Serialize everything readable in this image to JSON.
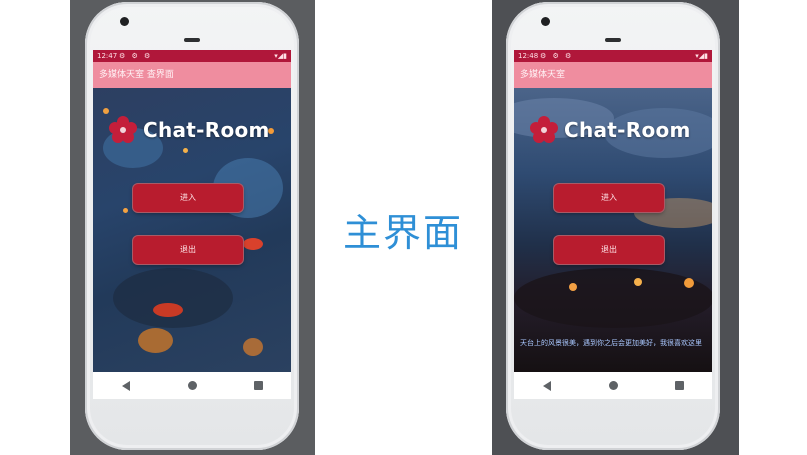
{
  "center_label": "主界面",
  "left_phone": {
    "status_time": "12:47",
    "status_icons": "⚙ ⚙ ⚙",
    "status_right": "▾◢▮",
    "app_title": "多媒体天室 查界面",
    "logo_text": "Chat-Room",
    "enter_button": "进入",
    "exit_button": "退出"
  },
  "right_phone": {
    "status_time": "12:48",
    "status_icons": "⚙ ⚙ ⚙",
    "status_right": "▾◢▮",
    "app_title": "多媒体天室",
    "logo_text": "Chat-Room",
    "enter_button": "进入",
    "exit_button": "退出",
    "caption": "天台上的风景很美，遇到你之后会更加美好，我很喜欢这里"
  },
  "colors": {
    "status_bar": "#b0173a",
    "app_bar": "#ef8d9f",
    "button": "#b81c2e",
    "title_blue": "#2e8fd6",
    "logo_red": "#c41e3a"
  },
  "icons": {
    "back": "back-triangle-icon",
    "home": "home-circle-icon",
    "recent": "recent-square-icon",
    "logo": "plum-flower-icon"
  }
}
